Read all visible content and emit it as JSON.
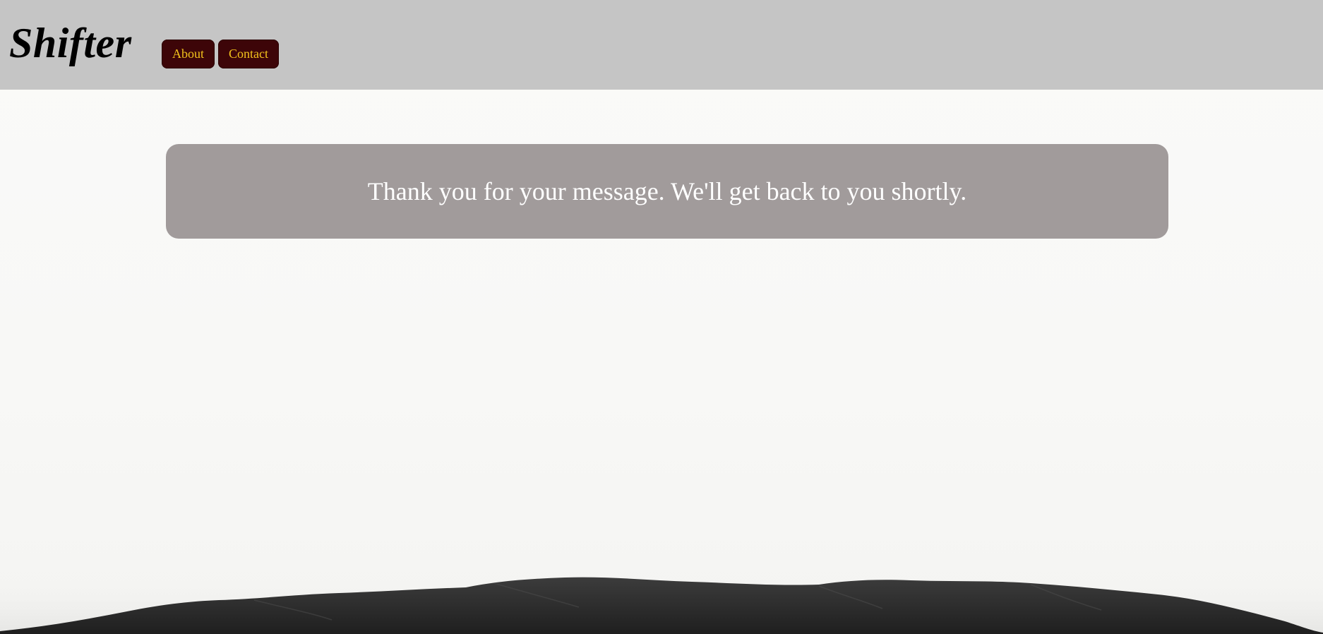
{
  "header": {
    "brand": "Shifter",
    "nav": [
      {
        "label": "About"
      },
      {
        "label": "Contact"
      }
    ]
  },
  "main": {
    "message": "Thank you for your message. We'll get back to you shortly."
  },
  "colors": {
    "header_bg": "#c5c5c5",
    "nav_button_bg": "#3d0508",
    "nav_button_text": "#f2c21c",
    "message_bg": "#a19b9b",
    "message_text": "#ffffff",
    "page_bg": "#fafaf9",
    "dune": "#2e2e2e"
  }
}
